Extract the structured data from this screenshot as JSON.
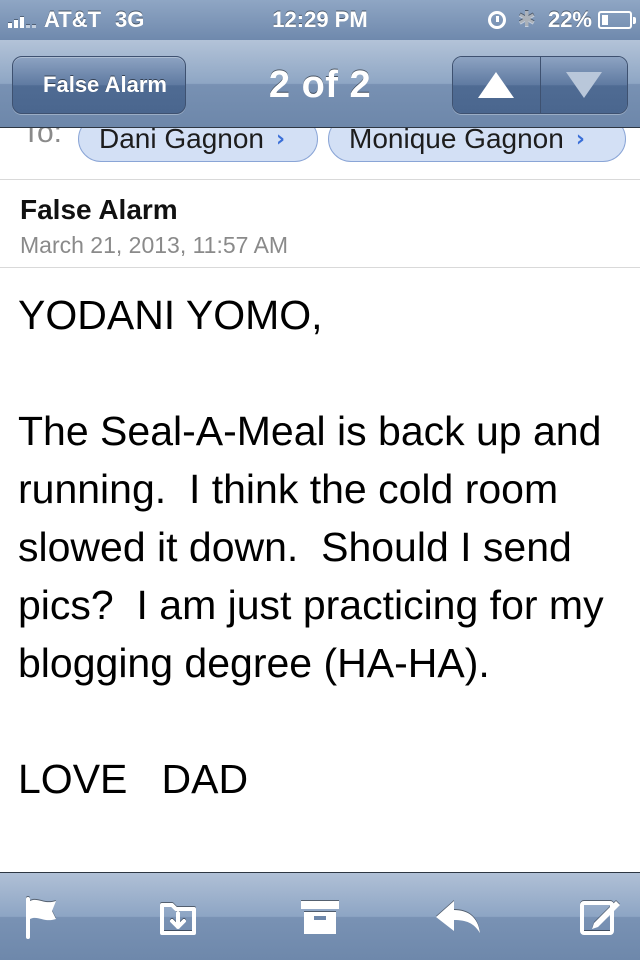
{
  "status_bar": {
    "carrier": "AT&T",
    "network": "3G",
    "time": "12:29 PM",
    "battery": "22%"
  },
  "nav": {
    "back_label": "False Alarm",
    "title": "2 of 2",
    "prev_icon": "triangle-up-icon",
    "next_icon": "triangle-down-icon"
  },
  "header": {
    "to_label": "To:",
    "recipients": [
      "Dani Gagnon",
      "Monique Gagnon"
    ],
    "subject": "False Alarm",
    "date": "March 21, 2013, 11:57 AM"
  },
  "body": {
    "greeting": "YODANI YOMO,",
    "paragraph": "The Seal-A-Meal is back up and running.  I think the cold room slowed it down.  Should I send pics?  I am just practicing for my blogging degree (HA-HA).",
    "signoff": "LOVE   DAD"
  },
  "toolbar": {
    "icons": [
      "flag-icon",
      "move-folder-icon",
      "archive-icon",
      "reply-icon",
      "compose-icon"
    ]
  },
  "colors": {
    "bar_blue": "#6d87aa",
    "recipient_fill": "#d3e0f5",
    "recipient_chevron": "#3a6fd8"
  }
}
